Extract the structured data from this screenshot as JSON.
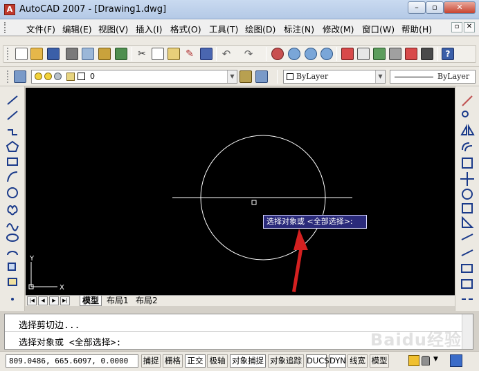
{
  "window": {
    "title": "AutoCAD 2007 - [Drawing1.dwg]",
    "minimize": "–",
    "restore": "▫",
    "close": "✕"
  },
  "menu": {
    "items": [
      "文件(F)",
      "编辑(E)",
      "视图(V)",
      "插入(I)",
      "格式(O)",
      "工具(T)",
      "绘图(D)",
      "标注(N)",
      "修改(M)",
      "窗口(W)",
      "帮助(H)"
    ],
    "mdi": {
      "minimize": "–",
      "restore": "▫",
      "close": "✕"
    }
  },
  "layers": {
    "current_layer": "0",
    "color": "ByLayer",
    "linetype": "ByLayer"
  },
  "canvas": {
    "tooltip": "选择对象或 <全部选择>:",
    "ucs_x": "X",
    "ucs_y": "Y"
  },
  "tabs": {
    "items": [
      "模型",
      "布局1",
      "布局2"
    ]
  },
  "command": {
    "history": "选择剪切边...",
    "prompt": "选择对象或 <全部选择>:"
  },
  "status": {
    "coordinates": "809.0486, 665.6097, 0.0000",
    "buttons": [
      "捕捉",
      "栅格",
      "正交",
      "极轴",
      "对象捕捉",
      "对象追踪",
      "DUCS",
      "DYN",
      "线宽",
      "模型"
    ]
  },
  "watermark": "Baidu经验",
  "colors": {
    "canvas": "#000000",
    "tooltip_bg": "#2a2a7a",
    "arrow": "#d42020",
    "titlebar": "#c9daf0"
  }
}
